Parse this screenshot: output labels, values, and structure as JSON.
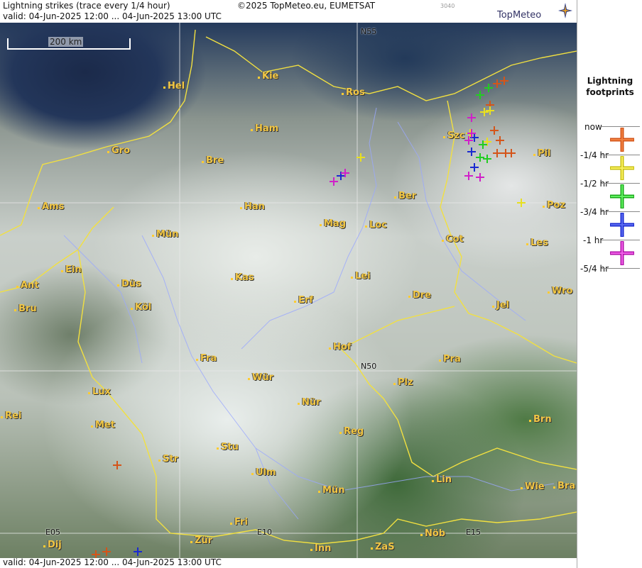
{
  "header": {
    "title": "Lightning strikes (trace every 1/4 hour)",
    "copyright": "©2025 TopMeteo.eu, EUMETSAT",
    "code": "3040",
    "valid": "valid:  04-Jun-2025 12:00 ... 04-Jun-2025 13:00 UTC",
    "logo": "TopMeteo"
  },
  "footer": {
    "valid": "valid:  04-Jun-2025 12:00 ... 04-Jun-2025 13:00 UTC"
  },
  "scale_label": "200 km",
  "grid_labels": {
    "n55": "N55",
    "n50": "N50",
    "e05": "E05",
    "e10": "E10",
    "e15": "E15"
  },
  "cities": [
    {
      "name": "Kie"
    },
    {
      "name": "Hel"
    },
    {
      "name": "Ros"
    },
    {
      "name": "Ham"
    },
    {
      "name": "Gro"
    },
    {
      "name": "Bre"
    },
    {
      "name": "Szc"
    },
    {
      "name": "Pil"
    },
    {
      "name": "Ams"
    },
    {
      "name": "Han"
    },
    {
      "name": "Ber"
    },
    {
      "name": "Poz"
    },
    {
      "name": "Mün"
    },
    {
      "name": "Mag"
    },
    {
      "name": "Loc"
    },
    {
      "name": "Cot"
    },
    {
      "name": "Ein"
    },
    {
      "name": "Les"
    },
    {
      "name": "Kas"
    },
    {
      "name": "Lei"
    },
    {
      "name": "Ant"
    },
    {
      "name": "Düs"
    },
    {
      "name": "Wro"
    },
    {
      "name": "Bru"
    },
    {
      "name": "Köl"
    },
    {
      "name": "Erf"
    },
    {
      "name": "Dre"
    },
    {
      "name": "Jel"
    },
    {
      "name": "Hof"
    },
    {
      "name": "Fra"
    },
    {
      "name": "Pra"
    },
    {
      "name": "Wür"
    },
    {
      "name": "Plz"
    },
    {
      "name": "Lux"
    },
    {
      "name": "Nür"
    },
    {
      "name": "Rei"
    },
    {
      "name": "Brn"
    },
    {
      "name": "Met"
    },
    {
      "name": "Reg"
    },
    {
      "name": "Stu"
    },
    {
      "name": "Str"
    },
    {
      "name": "Ulm"
    },
    {
      "name": "Lin"
    },
    {
      "name": "Mün"
    },
    {
      "name": "Wie"
    },
    {
      "name": "Bra"
    },
    {
      "name": "Fri"
    },
    {
      "name": "Dij"
    },
    {
      "name": "Zür"
    },
    {
      "name": "Inn"
    },
    {
      "name": "ZaS"
    },
    {
      "name": "Nöb"
    }
  ],
  "legend": {
    "title_line1": "Lightning",
    "title_line2": "footprints",
    "entries": [
      {
        "label": "now",
        "color": "#d4551a"
      },
      {
        "label": "-1/4 hr",
        "color": "#e8e020"
      },
      {
        "label": "-1/2 hr",
        "color": "#22cc22"
      },
      {
        "label": "-3/4 hr",
        "color": "#1a2ad0"
      },
      {
        "label": "-1 hr",
        "color": "#d020c8"
      },
      {
        "label": "-5/4 hr",
        "color": ""
      }
    ]
  }
}
